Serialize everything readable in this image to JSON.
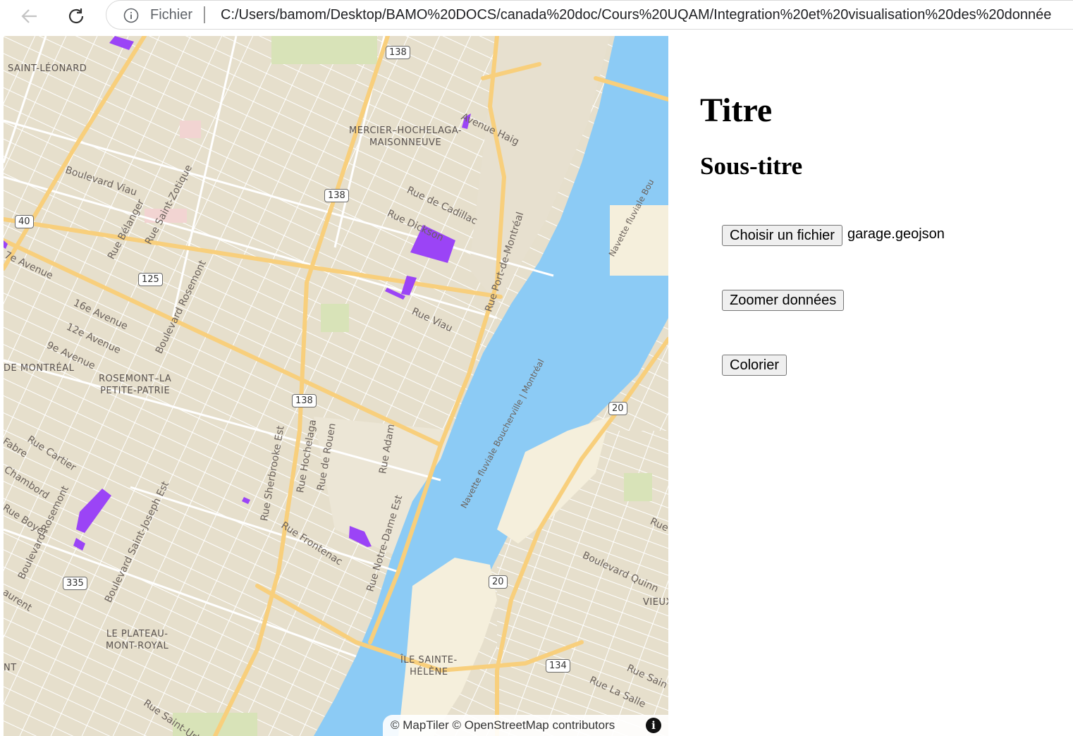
{
  "browser": {
    "address_label": "Fichier",
    "url": "C:/Users/bamom/Desktop/BAMO%20DOCS/canada%20doc/Cours%20UQAM/Integration%20et%20visualisation%20des%20donnée"
  },
  "map": {
    "districts": {
      "saint_leonard": "SAINT-LÉONARD",
      "mercier": "MERCIER–HOCHELAGA-\nMAISONNEUVE",
      "rosemont": "ROSEMONT–LA\nPETITE-PATRIE",
      "plateau": "LE PLATEAU-\nMONT-ROYAL",
      "ile_sainte_helene": "ÎLE SAINTE-\nHÉLÈNE",
      "de_montreal": "DE MONTRÉAL",
      "vieux": "VIEUX",
      "nt": "NT"
    },
    "streets": {
      "viau_blvd": "Boulevard Viau",
      "belanger": "Rue Bélanger",
      "saint_zotique": "Rue Saint-Zotique",
      "avenue_7": "7e Avenue",
      "avenue_16": "16e Avenue",
      "avenue_12": "12e Avenue",
      "avenue_9": "9e Avenue",
      "rosemont_blvd": "Boulevard Rosemont",
      "haig": "Avenue Haig",
      "cadillac": "Rue de Cadillac",
      "dickson": "Rue Dickson",
      "viau_rue": "Rue Viau",
      "port_de_montreal": "Rue Port-de-Montréal",
      "nav_bou": "Navette fluviale Bou",
      "nav_boucherville": "Navette fluviale Boucherville | Montréal",
      "nav_fluviale": "Navette fluviale Boucherville | Montréal",
      "cartier": "Rue Cartier",
      "fabre": "Fabre",
      "chambord": "Chambord",
      "boyer": "Rue Boyer",
      "rosemont_blvd2": "Boulevard Rosemont",
      "laurent": "aurent",
      "saint_joseph": "Boulevard Saint-Joseph Est",
      "sherbrooke": "Rue Sherbrooke Est",
      "hochelaga": "Rue Hochelaga",
      "rouen": "Rue de Rouen",
      "adam": "Rue Adam",
      "frontenac": "Rue Frontenac",
      "notre_dame": "Rue Notre-Dame Est",
      "quinn": "Boulevard Quinn",
      "saint_urbain": "Rue Saint-Urbain",
      "rue_sain": "Rue Sain",
      "la_salle": "Rue La Salle",
      "rue_e": "Rue"
    },
    "shields": {
      "s138a": "138",
      "s138b": "138",
      "s138c": "138",
      "s40": "40",
      "s125": "125",
      "s20a": "20",
      "s20b": "20",
      "s335": "335",
      "s134": "134"
    },
    "attribution": "© MapTiler © OpenStreetMap contributors",
    "info_glyph": "i",
    "colors": {
      "land": "#ece6d6",
      "water": "#8ccbf5",
      "major_road": "#f8cf7c",
      "minor_road": "#ffffff",
      "garage_polygon": "#9b44f6"
    }
  },
  "panel": {
    "title": "Titre",
    "subtitle": "Sous-titre",
    "file_button": "Choisir un fichier",
    "file_name": "garage.geojson",
    "zoom_button": "Zoomer données",
    "color_button": "Colorier"
  }
}
